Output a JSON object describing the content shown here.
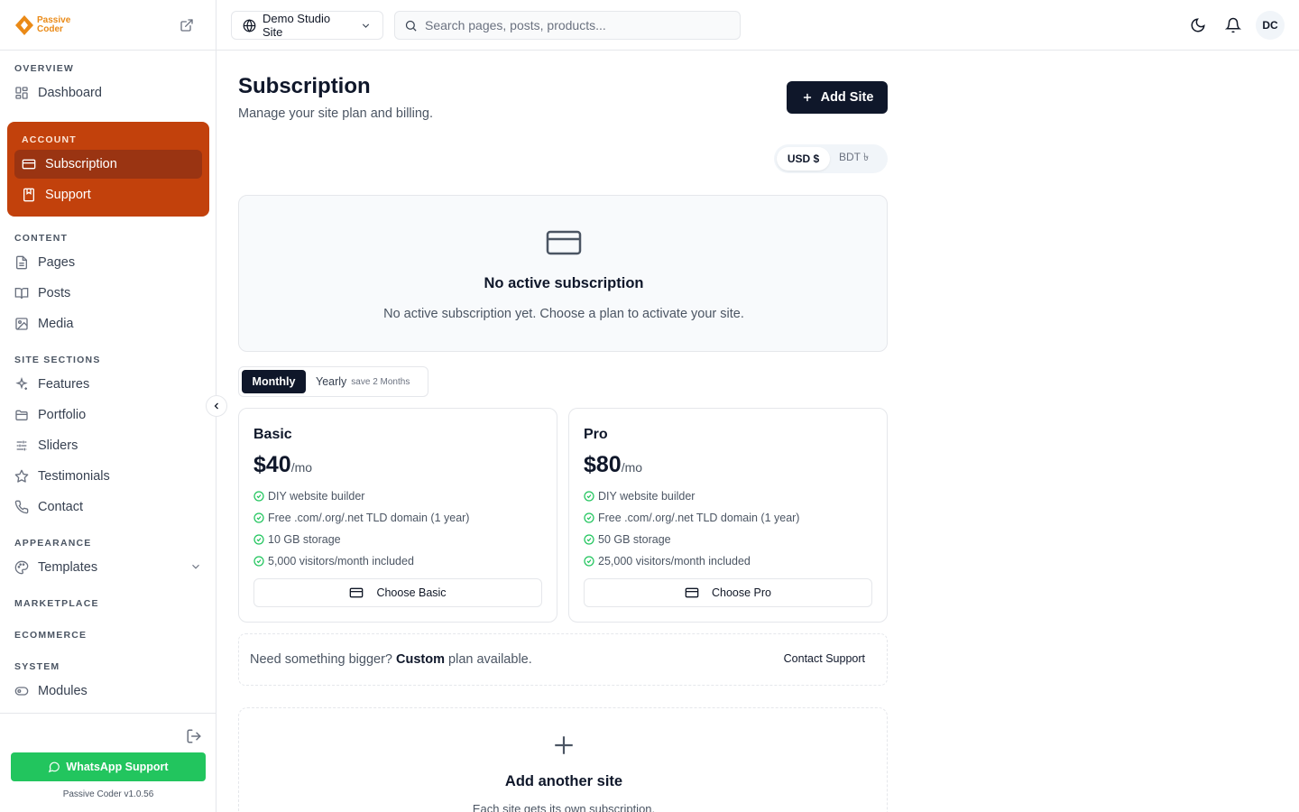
{
  "brand": {
    "line1": "Passive",
    "line2": "Coder",
    "accent": "#ea8a17"
  },
  "sidebar": {
    "overview_label": "OVERVIEW",
    "dashboard": "Dashboard",
    "account_label": "ACCOUNT",
    "subscription": "Subscription",
    "support": "Support",
    "content_label": "CONTENT",
    "pages": "Pages",
    "posts": "Posts",
    "media": "Media",
    "site_sections_label": "SITE SECTIONS",
    "features": "Features",
    "portfolio": "Portfolio",
    "sliders": "Sliders",
    "testimonials": "Testimonials",
    "contact": "Contact",
    "appearance_label": "APPEARANCE",
    "templates": "Templates",
    "marketplace_label": "MARKETPLACE",
    "ecommerce_label": "ECOMMERCE",
    "system_label": "SYSTEM",
    "modules": "Modules",
    "whatsapp": "WhatsApp Support",
    "version": "Passive Coder v1.0.56",
    "account_color": "#c2410c",
    "whatsapp_color": "#22c55e"
  },
  "topbar": {
    "site": "Demo Studio Site",
    "search_placeholder": "Search pages, posts, products...",
    "avatar": "DC"
  },
  "main": {
    "title": "Subscription",
    "subtitle": "Manage your site plan and billing.",
    "add_site": "Add Site",
    "currency": {
      "usd": "USD $",
      "bdt": "BDT ৳"
    },
    "empty": {
      "title": "No active subscription",
      "text": "No active subscription yet. Choose a plan to activate your site."
    },
    "period": {
      "monthly": "Monthly",
      "yearly": "Yearly",
      "yearly_note": "save 2 Months"
    },
    "plans": [
      {
        "name": "Basic",
        "price": "$40",
        "per": "/mo",
        "features": [
          "DIY website builder",
          "Free .com/.org/.net TLD domain (1 year)",
          "10 GB storage",
          "5,000 visitors/month included"
        ],
        "cta": "Choose Basic"
      },
      {
        "name": "Pro",
        "price": "$80",
        "per": "/mo",
        "features": [
          "DIY website builder",
          "Free .com/.org/.net TLD domain (1 year)",
          "50 GB storage",
          "25,000 visitors/month included"
        ],
        "cta": "Choose Pro"
      }
    ],
    "custom": {
      "prefix": "Need something bigger?",
      "bold": "Custom",
      "suffix": "plan available.",
      "cta": "Contact Support"
    },
    "add_another": {
      "title": "Add another site",
      "text": "Each site gets its own subscription."
    }
  }
}
